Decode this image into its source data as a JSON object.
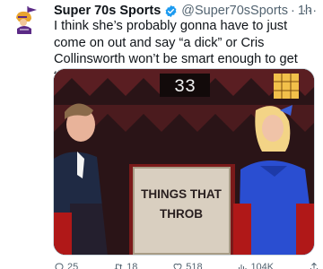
{
  "tweet": {
    "display_name": "Super 70s Sports",
    "handle": "@Super70sSports",
    "separator": "·",
    "time": "1h",
    "more": "···",
    "text": "I think she’s probably gonna have to just come on out and say “a dick” or Cris Collinsworth won’t be smart enough to get this one ...",
    "verified_icon": "verified-badge-icon",
    "accent_color": "#1d9bf0"
  },
  "media": {
    "score": "33",
    "card_line1": "THINGS THAT",
    "card_line2": "THROB"
  },
  "actions": {
    "reply_count": "25",
    "retweet_count": "18",
    "like_count": "518",
    "views_count": "104K"
  }
}
